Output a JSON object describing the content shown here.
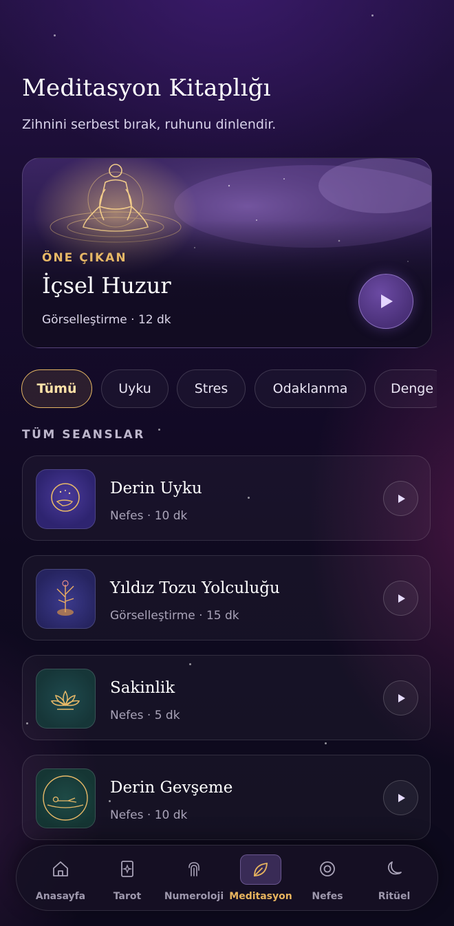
{
  "header": {
    "title": "Meditasyon Kitaplığı",
    "subtitle": "Zihnini serbest bırak, ruhunu dinlendir."
  },
  "featured": {
    "badge": "ÖNE ÇIKAN",
    "title": "İçsel Huzur",
    "meta": "Görselleştirme · 12 dk",
    "play_icon": "play-icon"
  },
  "filters": {
    "selected": "Tümü",
    "items": [
      "Tümü",
      "Uyku",
      "Stres",
      "Odaklanma",
      "Denge"
    ]
  },
  "sessions": {
    "section_title": "TÜM SEANSLAR",
    "items": [
      {
        "title": "Derin Uyku",
        "meta": "Nefes · 10 dk"
      },
      {
        "title": "Yıldız Tozu Yolculuğu",
        "meta": "Görselleştirme · 15 dk"
      },
      {
        "title": "Sakinlik",
        "meta": "Nefes · 5 dk"
      },
      {
        "title": "Derin Gevşeme",
        "meta": "Nefes · 10 dk"
      }
    ]
  },
  "nav": {
    "active": "Meditasyon",
    "items": [
      {
        "label": "Anasayfa",
        "icon": "home-icon"
      },
      {
        "label": "Tarot",
        "icon": "tarot-card-icon"
      },
      {
        "label": "Numeroloji",
        "icon": "fingerprint-icon"
      },
      {
        "label": "Meditasyon",
        "icon": "leaf-icon"
      },
      {
        "label": "Nefes",
        "icon": "target-circle-icon"
      },
      {
        "label": "Ritüel",
        "icon": "moon-icon"
      }
    ]
  },
  "colors": {
    "accent_gold": "#e3b563",
    "accent_purple": "#6b4aa3",
    "background": "#160b2c"
  }
}
